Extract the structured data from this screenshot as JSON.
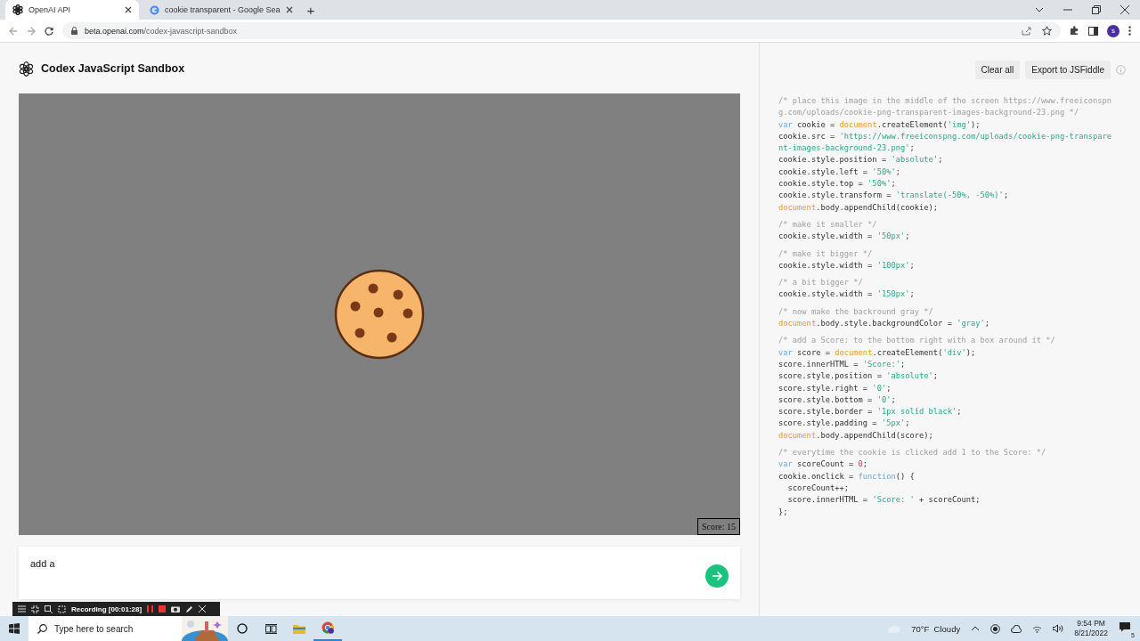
{
  "browser": {
    "tabs": [
      {
        "title": "OpenAI API",
        "selected": true
      },
      {
        "title": "cookie transparent - Google Sea",
        "selected": false
      }
    ],
    "new_tab": "+",
    "address": {
      "host": "beta.openai.com",
      "path": "/codex-javascript-sandbox"
    },
    "profile_initial": "s"
  },
  "app": {
    "title": "Codex JavaScript Sandbox"
  },
  "preview": {
    "score": "Score: 15"
  },
  "prompt": {
    "value": "add a"
  },
  "toolbar": {
    "buttons": [
      "Clear all",
      "Export to JSFiddle"
    ]
  },
  "code": [
    [
      [
        {
          "kind": "comment",
          "text": "/* place this image in the middle of the screen https://www.freeiconspng.com/uploads/cookie-png-transparent-images-background-23.png */"
        }
      ],
      [
        {
          "kind": "keyword",
          "text": "var"
        },
        {
          "kind": "plain",
          "text": " cookie = "
        },
        {
          "kind": "global",
          "text": "document"
        },
        {
          "kind": "plain",
          "text": ".createElement("
        },
        {
          "kind": "string",
          "text": "'img'"
        },
        {
          "kind": "plain",
          "text": ");"
        }
      ],
      [
        {
          "kind": "plain",
          "text": "cookie.src = "
        },
        {
          "kind": "string",
          "text": "'https://www.freeiconspng.com/uploads/cookie-png-transparent-images-background-23.png'"
        },
        {
          "kind": "plain",
          "text": ";"
        }
      ],
      [
        {
          "kind": "plain",
          "text": "cookie.style.position = "
        },
        {
          "kind": "string",
          "text": "'absolute'"
        },
        {
          "kind": "plain",
          "text": ";"
        }
      ],
      [
        {
          "kind": "plain",
          "text": "cookie.style.left = "
        },
        {
          "kind": "string",
          "text": "'50%'"
        },
        {
          "kind": "plain",
          "text": ";"
        }
      ],
      [
        {
          "kind": "plain",
          "text": "cookie.style.top = "
        },
        {
          "kind": "string",
          "text": "'50%'"
        },
        {
          "kind": "plain",
          "text": ";"
        }
      ],
      [
        {
          "kind": "plain",
          "text": "cookie.style.transform = "
        },
        {
          "kind": "string",
          "text": "'translate(-50%, -50%)'"
        },
        {
          "kind": "plain",
          "text": ";"
        }
      ],
      [
        {
          "kind": "global",
          "text": "document"
        },
        {
          "kind": "plain",
          "text": ".body.appendChild(cookie);"
        }
      ]
    ],
    [
      [
        {
          "kind": "comment",
          "text": "/* make it smaller */"
        }
      ],
      [
        {
          "kind": "plain",
          "text": "cookie.style.width = "
        },
        {
          "kind": "string",
          "text": "'50px'"
        },
        {
          "kind": "plain",
          "text": ";"
        }
      ]
    ],
    [
      [
        {
          "kind": "comment",
          "text": "/* make it bigger */"
        }
      ],
      [
        {
          "kind": "plain",
          "text": "cookie.style.width = "
        },
        {
          "kind": "string",
          "text": "'100px'"
        },
        {
          "kind": "plain",
          "text": ";"
        }
      ]
    ],
    [
      [
        {
          "kind": "comment",
          "text": "/* a bit bigger */"
        }
      ],
      [
        {
          "kind": "plain",
          "text": "cookie.style.width = "
        },
        {
          "kind": "string",
          "text": "'150px'"
        },
        {
          "kind": "plain",
          "text": ";"
        }
      ]
    ],
    [
      [
        {
          "kind": "comment",
          "text": "/* now make the backround gray */"
        }
      ],
      [
        {
          "kind": "global",
          "text": "document"
        },
        {
          "kind": "plain",
          "text": ".body.style.backgroundColor = "
        },
        {
          "kind": "string",
          "text": "'gray'"
        },
        {
          "kind": "plain",
          "text": ";"
        }
      ]
    ],
    [
      [
        {
          "kind": "comment",
          "text": "/* add a Score: to the bottom right with a box around it */"
        }
      ],
      [
        {
          "kind": "keyword",
          "text": "var"
        },
        {
          "kind": "plain",
          "text": " score = "
        },
        {
          "kind": "global",
          "text": "document"
        },
        {
          "kind": "plain",
          "text": ".createElement("
        },
        {
          "kind": "string",
          "text": "'div'"
        },
        {
          "kind": "plain",
          "text": ");"
        }
      ],
      [
        {
          "kind": "plain",
          "text": "score.innerHTML = "
        },
        {
          "kind": "string",
          "text": "'Score:'"
        },
        {
          "kind": "plain",
          "text": ";"
        }
      ],
      [
        {
          "kind": "plain",
          "text": "score.style.position = "
        },
        {
          "kind": "string",
          "text": "'absolute'"
        },
        {
          "kind": "plain",
          "text": ";"
        }
      ],
      [
        {
          "kind": "plain",
          "text": "score.style.right = "
        },
        {
          "kind": "string",
          "text": "'0'"
        },
        {
          "kind": "plain",
          "text": ";"
        }
      ],
      [
        {
          "kind": "plain",
          "text": "score.style.bottom = "
        },
        {
          "kind": "string",
          "text": "'0'"
        },
        {
          "kind": "plain",
          "text": ";"
        }
      ],
      [
        {
          "kind": "plain",
          "text": "score.style.border = "
        },
        {
          "kind": "string",
          "text": "'1px solid black'"
        },
        {
          "kind": "plain",
          "text": ";"
        }
      ],
      [
        {
          "kind": "plain",
          "text": "score.style.padding = "
        },
        {
          "kind": "string",
          "text": "'5px'"
        },
        {
          "kind": "plain",
          "text": ";"
        }
      ],
      [
        {
          "kind": "global",
          "text": "document"
        },
        {
          "kind": "plain",
          "text": ".body.appendChild(score);"
        }
      ]
    ],
    [
      [
        {
          "kind": "comment",
          "text": "/* everytime the cookie is clicked add 1 to the Score: */"
        }
      ],
      [
        {
          "kind": "keyword",
          "text": "var"
        },
        {
          "kind": "plain",
          "text": " scoreCount = "
        },
        {
          "kind": "number",
          "text": "0"
        },
        {
          "kind": "plain",
          "text": ";"
        }
      ],
      [
        {
          "kind": "plain",
          "text": "cookie.onclick = "
        },
        {
          "kind": "keyword",
          "text": "function"
        },
        {
          "kind": "plain",
          "text": "() {"
        }
      ],
      [
        {
          "kind": "plain",
          "text": "  scoreCount++;"
        }
      ],
      [
        {
          "kind": "plain",
          "text": "  score.innerHTML = "
        },
        {
          "kind": "string",
          "text": "'Score: '"
        },
        {
          "kind": "plain",
          "text": " + scoreCount;"
        }
      ],
      [
        {
          "kind": "plain",
          "text": "};"
        }
      ]
    ]
  ],
  "recorder": {
    "status": "Recording [00:01:28]"
  },
  "taskbar": {
    "search_placeholder": "Type here to search",
    "weather": "70°F  Cloudy",
    "time": "9:54 PM",
    "date": "8/21/2022",
    "notifications": "5"
  }
}
